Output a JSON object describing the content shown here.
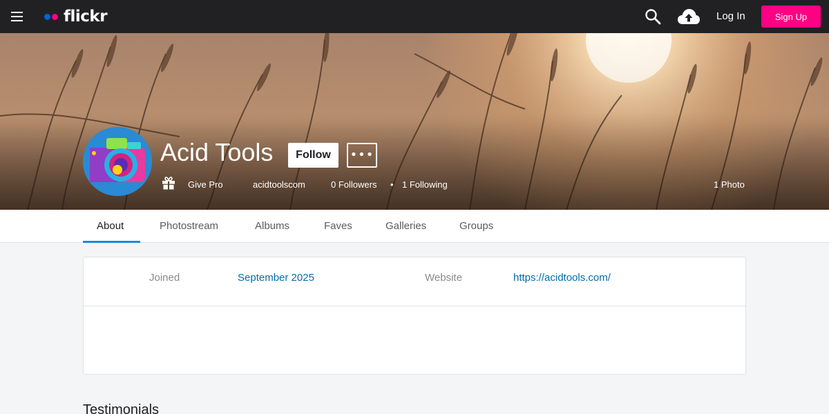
{
  "brand": {
    "name": "flickr",
    "colors": {
      "blue": "#0063dc",
      "pink": "#ff0084",
      "nav_bg": "#212124",
      "accent": "#128fdc",
      "link": "#006dac"
    }
  },
  "topnav": {
    "menu_icon": "hamburger-menu-icon",
    "search_icon": "search-icon",
    "upload_icon": "cloud-upload-icon",
    "login_label": "Log In",
    "signup_label": "Sign Up"
  },
  "profile": {
    "name": "Acid Tools",
    "follow_label": "Follow",
    "more_label": "•••",
    "give_pro_label": "Give Pro",
    "username": "acidtoolscom",
    "followers": "0 Followers",
    "separator": "•",
    "following": "1 Following",
    "photos": "1 Photo"
  },
  "tabs": [
    {
      "label": "About",
      "active": true
    },
    {
      "label": "Photostream",
      "active": false
    },
    {
      "label": "Albums",
      "active": false
    },
    {
      "label": "Faves",
      "active": false
    },
    {
      "label": "Galleries",
      "active": false
    },
    {
      "label": "Groups",
      "active": false
    }
  ],
  "about": {
    "joined_label": "Joined",
    "joined_value": "September 2025",
    "website_label": "Website",
    "website_value": "https://acidtools.com/"
  },
  "testimonials": {
    "title": "Testimonials"
  }
}
